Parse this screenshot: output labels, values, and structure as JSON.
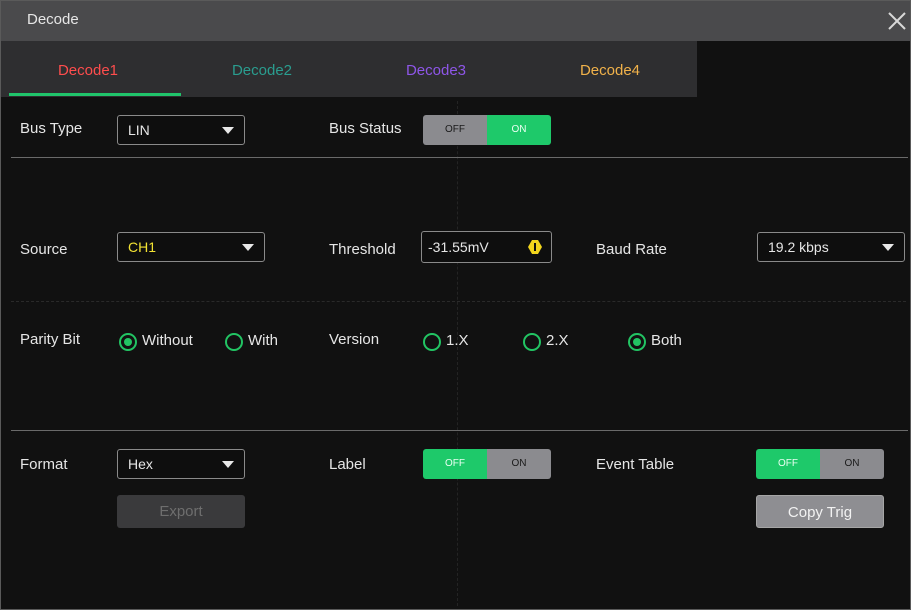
{
  "window": {
    "title": "Decode"
  },
  "tabs": [
    {
      "label": "Decode1",
      "color": "#ff4d4d"
    },
    {
      "label": "Decode2",
      "color": "#2a9d8f"
    },
    {
      "label": "Decode3",
      "color": "#8e56e8"
    },
    {
      "label": "Decode4",
      "color": "#f1b24a"
    }
  ],
  "active_tab": "Decode1",
  "bus_type": {
    "label": "Bus Type",
    "value": "LIN"
  },
  "bus_status": {
    "label": "Bus Status",
    "off": "OFF",
    "on": "ON",
    "state": "ON"
  },
  "source": {
    "label": "Source",
    "value": "CH1",
    "value_color": "#f2e233"
  },
  "threshold": {
    "label": "Threshold",
    "value": "-31.55mV"
  },
  "baud_rate": {
    "label": "Baud Rate",
    "value": "19.2 kbps"
  },
  "parity_bit": {
    "label": "Parity Bit",
    "options": [
      "Without",
      "With"
    ],
    "selected": "Without"
  },
  "version": {
    "label": "Version",
    "options": [
      "1.X",
      "2.X",
      "Both"
    ],
    "selected": "Both"
  },
  "format": {
    "label": "Format",
    "value": "Hex"
  },
  "label_toggle": {
    "label": "Label",
    "off": "OFF",
    "on": "ON",
    "state": "OFF"
  },
  "event_table": {
    "label": "Event Table",
    "off": "OFF",
    "on": "ON",
    "state": "OFF"
  },
  "buttons": {
    "export": "Export",
    "copy_trig": "Copy Trig"
  },
  "colors": {
    "accent_green": "#1ec96a",
    "threshold_knob": "#f2d51c"
  },
  "icons": {
    "close": "close-icon",
    "dropdown": "chevron-down-icon",
    "knob": "adjust-knob-icon"
  }
}
